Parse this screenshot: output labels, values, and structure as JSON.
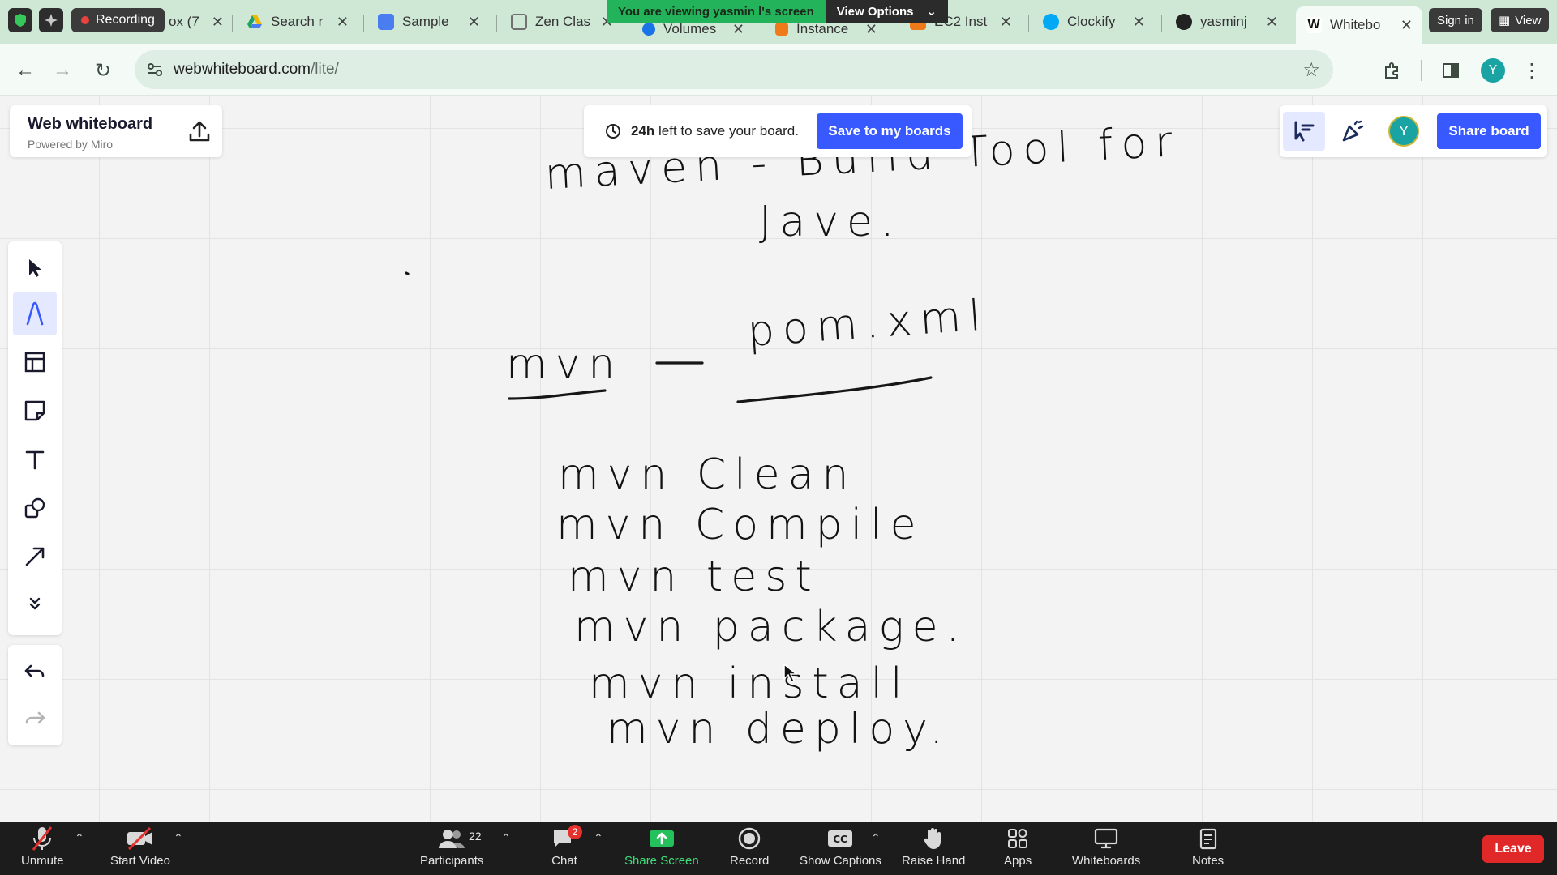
{
  "browser": {
    "recording_label": "Recording",
    "tabs": [
      {
        "title": "ox (7",
        "color": "#9a9a9a"
      },
      {
        "title": "Search r",
        "color": "#f2b800"
      },
      {
        "title": "Sample",
        "color": "#4a7df0"
      },
      {
        "title": "Zen Clas",
        "color": "#707070"
      },
      {
        "title": "Volumes",
        "color": "#1b73e8"
      },
      {
        "title": "Instance",
        "color": "#ef7a1a"
      },
      {
        "title": "EC2 Inst",
        "color": "#ef7a1a"
      },
      {
        "title": "Clockify",
        "color": "#03a9f4"
      },
      {
        "title": "yasminj",
        "color": "#222222"
      },
      {
        "title": "Whitebo",
        "color": "#111111"
      }
    ],
    "share_banner": {
      "text": "You are viewing yasmin l's screen",
      "options": "View Options"
    },
    "sign_in": "Sign in",
    "view": "View",
    "url_domain": "webwhiteboard.com",
    "url_path": "/lite/",
    "profile_initial": "Y"
  },
  "whiteboard": {
    "brand_name": "Web whiteboard",
    "brand_sub": "Powered by Miro",
    "save_hours": "24h",
    "save_msg": "left to save your board.",
    "save_button": "Save to my boards",
    "avatar_initial": "Y",
    "share_button": "Share board",
    "handwriting": {
      "line1": "maven - Build Tool for",
      "line2": "Jave.",
      "line3_left": "mvn",
      "line3_dash": "—",
      "line3_right": "pom.xml",
      "cmd1": "mvn Clean",
      "cmd2": "mvn Compile",
      "cmd3": "mvn test",
      "cmd4": "mvn package.",
      "cmd5": "mvn install",
      "cmd6": "mvn deploy."
    }
  },
  "meeting": {
    "unmute": "Unmute",
    "start_video": "Start Video",
    "participants": "Participants",
    "participant_count": "22",
    "chat": "Chat",
    "chat_badge": "2",
    "share_screen": "Share Screen",
    "record": "Record",
    "show_captions": "Show Captions",
    "raise_hand": "Raise Hand",
    "apps": "Apps",
    "whiteboards": "Whiteboards",
    "notes": "Notes",
    "leave": "Leave"
  }
}
